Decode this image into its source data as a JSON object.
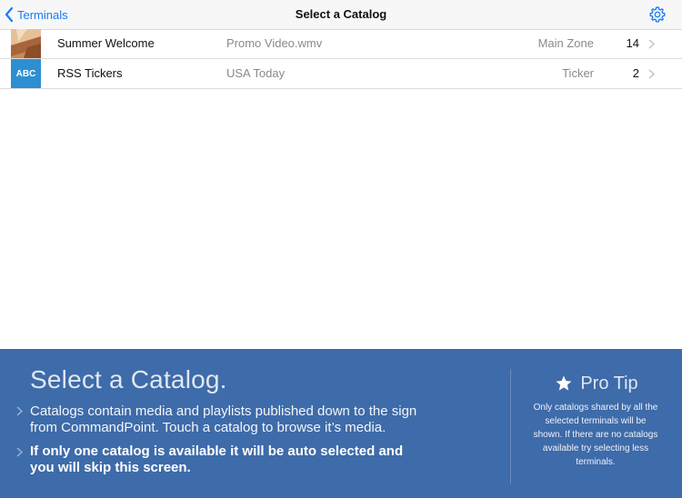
{
  "navbar": {
    "back_label": "Terminals",
    "title": "Select a Catalog",
    "settings_icon": "gear-icon"
  },
  "catalogs": [
    {
      "name": "Summer Welcome",
      "media": "Promo Video.wmv",
      "zone": "Main Zone",
      "count": "14",
      "thumb_icon": "summer-thumbnail"
    },
    {
      "name": "RSS Tickers",
      "media": "USA Today",
      "zone": "Ticker",
      "count": "2",
      "thumb_icon": "abc-thumbnail",
      "thumb_text": "ABC"
    }
  ],
  "help": {
    "title": "Select a Catalog.",
    "items": [
      "Catalogs contain media and playlists published down to the sign from CommandPoint. Touch a catalog to browse it’s media.",
      "If only one catalog is available it will be auto selected and you will skip this screen."
    ],
    "pro_tip_title": "Pro Tip",
    "pro_tip_body": "Only catalogs shared by all the selected terminals will be shown. If there are no catalogs available try selecting less terminals."
  },
  "colors": {
    "accent": "#1a7cf5",
    "help_bg": "#3e6ba9",
    "abc_thumb": "#2d8fd1"
  }
}
